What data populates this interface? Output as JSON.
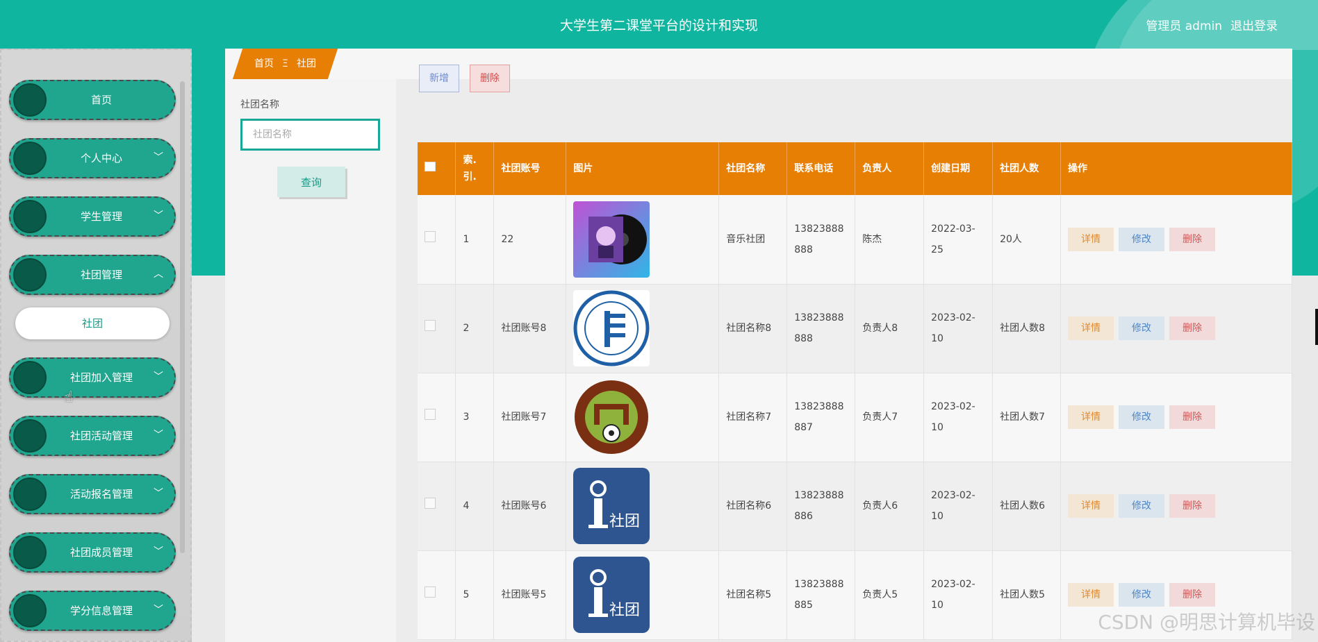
{
  "header": {
    "title": "大学生第二课堂平台的设计和实现",
    "user_label": "管理员 admin",
    "logout_label": "退出登录"
  },
  "sidebar": {
    "items": [
      {
        "label": "首页",
        "has_chevron": false
      },
      {
        "label": "个人中心",
        "chevron": "﹀"
      },
      {
        "label": "学生管理",
        "chevron": "﹀"
      },
      {
        "label": "社团管理",
        "chevron": "︿"
      },
      {
        "label": "社团加入管理",
        "chevron": "﹀"
      },
      {
        "label": "社团活动管理",
        "chevron": "﹀"
      },
      {
        "label": "活动报名管理",
        "chevron": "﹀"
      },
      {
        "label": "社团成员管理",
        "chevron": "﹀"
      },
      {
        "label": "学分信息管理",
        "chevron": "﹀"
      }
    ],
    "sub_item": "社团"
  },
  "breadcrumb": {
    "home": "首页",
    "separator": "Ξ",
    "current": "社团"
  },
  "filter": {
    "label": "社团名称",
    "placeholder": "社团名称",
    "query_button": "查询"
  },
  "toolbar": {
    "add_label": "新增",
    "delete_label": "删除"
  },
  "table": {
    "headers": [
      "索.引.",
      "社团账号",
      "图片",
      "社团名称",
      "联系电话",
      "负责人",
      "创建日期",
      "社团人数",
      "操作"
    ],
    "rows": [
      {
        "index": "1",
        "account": "22",
        "image": "music-album-image",
        "name": "音乐社团",
        "phone_a": "13823888",
        "phone_b": "888",
        "leader": "陈杰",
        "date_a": "2022-03-",
        "date_b": "25",
        "members": "20人"
      },
      {
        "index": "2",
        "account": "社团账号8",
        "image": "music-association-logo",
        "name": "社团名称8",
        "phone_a": "13823888",
        "phone_b": "888",
        "leader": "负责人8",
        "date_a": "2023-02-",
        "date_b": "10",
        "members": "社团人数8"
      },
      {
        "index": "3",
        "account": "社团账号7",
        "image": "football-association-logo",
        "name": "社团名称7",
        "phone_a": "13823888",
        "phone_b": "887",
        "leader": "负责人7",
        "date_a": "2023-02-",
        "date_b": "10",
        "members": "社团人数7"
      },
      {
        "index": "4",
        "account": "社团账号6",
        "image": "club-i-logo",
        "name": "社团名称6",
        "phone_a": "13823888",
        "phone_b": "886",
        "leader": "负责人6",
        "date_a": "2023-02-",
        "date_b": "10",
        "members": "社团人数6"
      },
      {
        "index": "5",
        "account": "社团账号5",
        "image": "club-i-logo",
        "name": "社团名称5",
        "phone_a": "13823888",
        "phone_b": "885",
        "leader": "负责人5",
        "date_a": "2023-02-",
        "date_b": "10",
        "members": "社团人数5"
      }
    ],
    "action_labels": {
      "detail": "详情",
      "edit": "修改",
      "delete": "删除"
    },
    "logo_text": "社团"
  },
  "watermark": "CSDN @明思计算机毕设",
  "colors": {
    "brand_teal": "#10b5a0",
    "accent_orange": "#e77f05"
  }
}
